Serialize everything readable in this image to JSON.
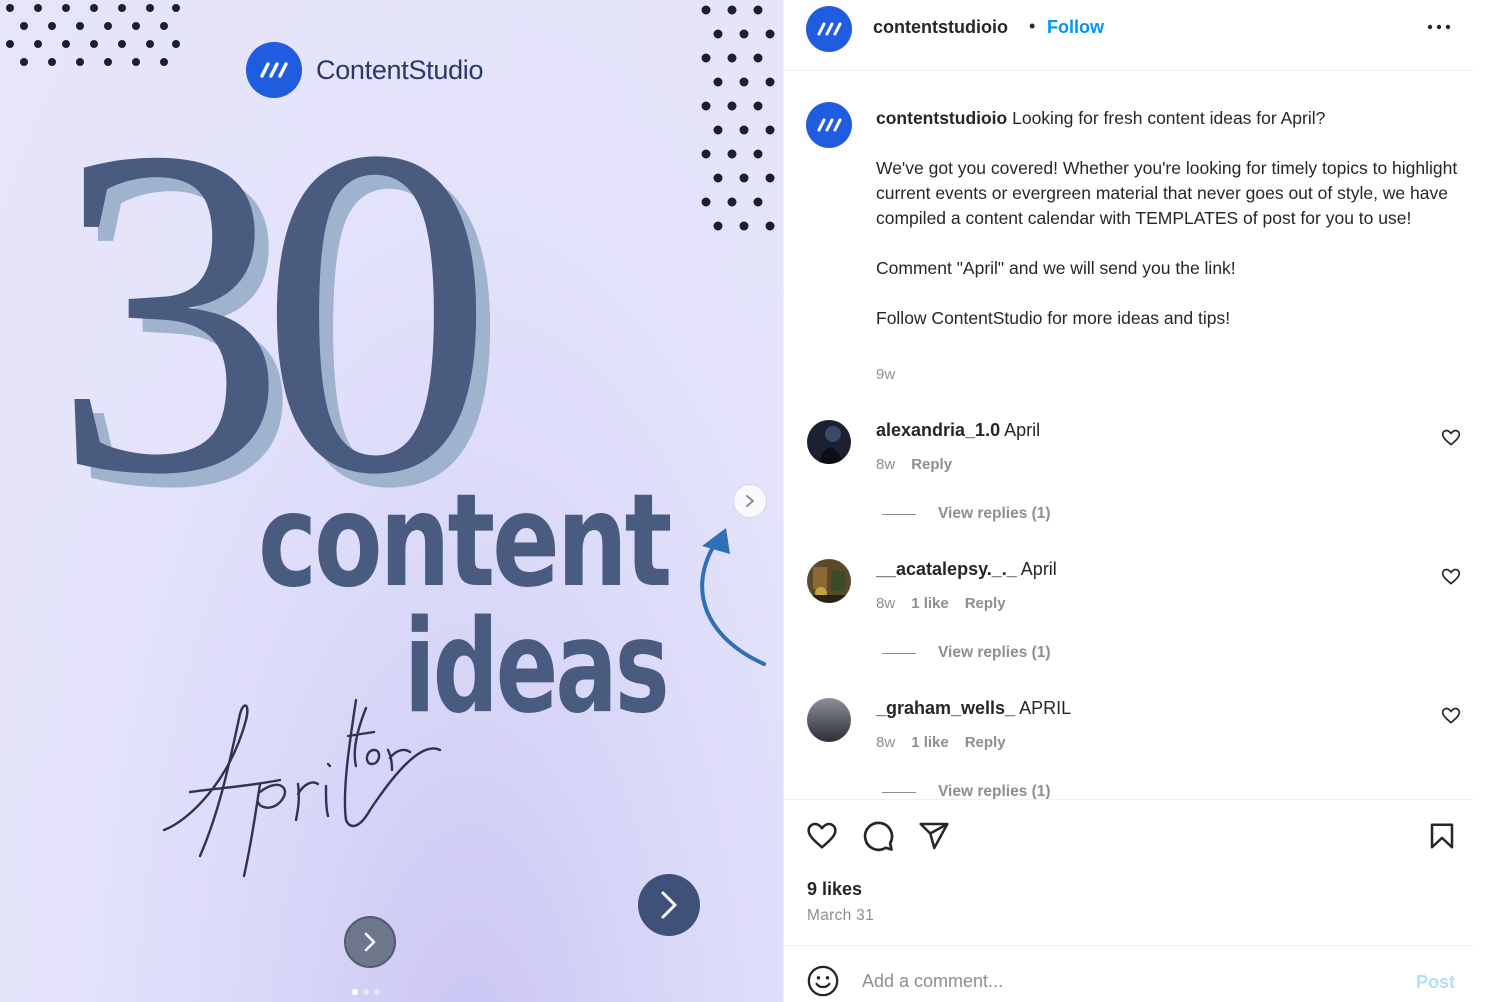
{
  "media": {
    "brand_name": "ContentStudio",
    "headline_number": "30",
    "headline_word1": "content",
    "headline_word2": "ideas",
    "script_text": "for April",
    "carousel_count": 3,
    "carousel_active": 1,
    "accent_color": "#1f5ce0",
    "headline_color": "#4a5b80"
  },
  "header": {
    "username": "contentstudioio",
    "separator": "•",
    "follow_label": "Follow",
    "avatar_icon": "contentstudio-logo-icon",
    "more_icon": "more-horizontal-icon"
  },
  "caption": {
    "username": "contentstudioio",
    "first_line": "Looking for fresh content ideas for April?",
    "paragraph1": "We've got you covered! Whether you're looking for timely topics to highlight current events or evergreen material that never goes out of style, we have compiled a content calendar with TEMPLATES of post for you to use!",
    "paragraph2": "Comment \"April\" and we will send you the link!",
    "paragraph3": "Follow ContentStudio for more ideas and tips!",
    "time": "9w"
  },
  "comments": [
    {
      "username": "alexandria_1.0",
      "text": "April",
      "time": "8w",
      "likes": "",
      "reply_label": "Reply",
      "view_replies": "View replies (1)"
    },
    {
      "username": "__acatalepsy._._",
      "text": "April",
      "time": "8w",
      "likes": "1 like",
      "reply_label": "Reply",
      "view_replies": "View replies (1)"
    },
    {
      "username": "_graham_wells_",
      "text": "APRIL",
      "time": "8w",
      "likes": "1 like",
      "reply_label": "Reply",
      "view_replies": "View replies (1)"
    }
  ],
  "actions": {
    "icons": [
      "heart-icon",
      "comment-icon",
      "share-icon",
      "bookmark-icon"
    ],
    "likes_label": "9 likes",
    "date": "March 31"
  },
  "composer": {
    "placeholder": "Add a comment...",
    "post_label": "Post",
    "emoji_icon": "emoji-icon"
  }
}
